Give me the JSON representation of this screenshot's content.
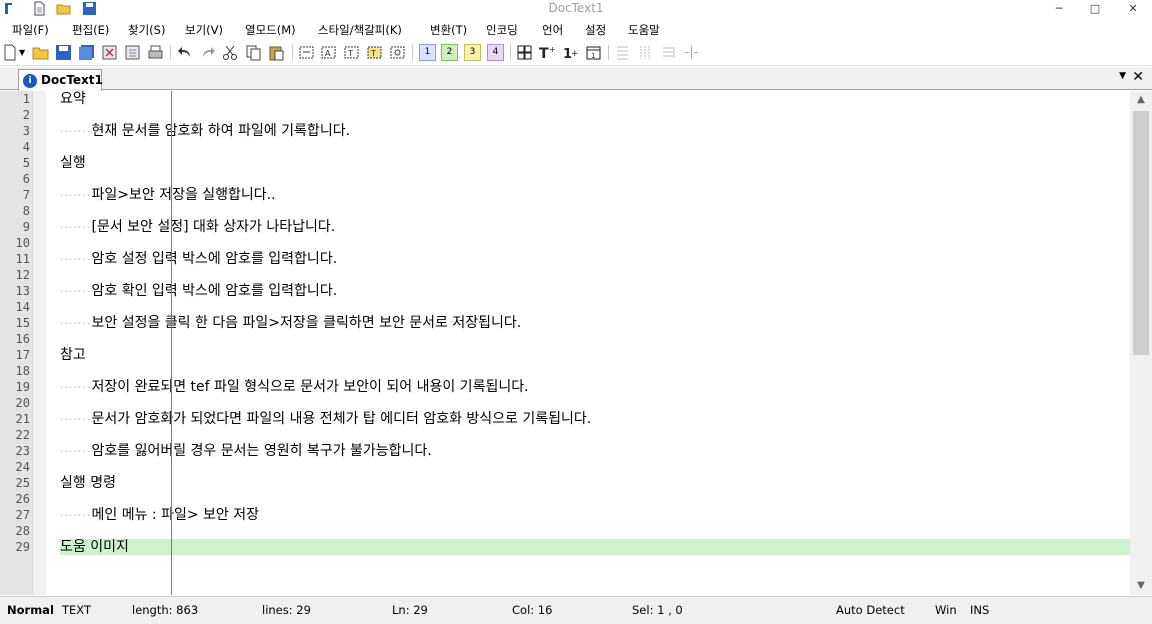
{
  "window": {
    "title": "DocText1"
  },
  "menu": [
    "파일(F)",
    "편집(E)",
    "찾기(S)",
    "보기(V)",
    "열모드(M)",
    "스타일/책갈피(K)",
    "변환(T)",
    "인코딩",
    "언어",
    "설정",
    "도움말"
  ],
  "toolbar": {
    "num_buttons": [
      "1",
      "2",
      "3",
      "4"
    ]
  },
  "tab": {
    "label": "DocText1"
  },
  "lines": [
    {
      "num": "1",
      "indent": false,
      "text": "요약"
    },
    {
      "num": "2",
      "indent": false,
      "text": ""
    },
    {
      "num": "3",
      "indent": true,
      "text": "현재 문서를 암호화 하여 파일에 기록합니다."
    },
    {
      "num": "4",
      "indent": false,
      "text": ""
    },
    {
      "num": "5",
      "indent": false,
      "text": "실행"
    },
    {
      "num": "6",
      "indent": false,
      "text": ""
    },
    {
      "num": "7",
      "indent": true,
      "text": "파일>보안 저장을 실행합니다.."
    },
    {
      "num": "8",
      "indent": false,
      "text": ""
    },
    {
      "num": "9",
      "indent": true,
      "text": "[문서 보안 설정] 대화 상자가 나타납니다."
    },
    {
      "num": "10",
      "indent": false,
      "text": ""
    },
    {
      "num": "11",
      "indent": true,
      "text": "암호 설정 입력 박스에 암호를 입력합니다."
    },
    {
      "num": "12",
      "indent": false,
      "text": ""
    },
    {
      "num": "13",
      "indent": true,
      "text": "암호 확인 입력 박스에 암호를 입력합니다."
    },
    {
      "num": "14",
      "indent": false,
      "text": ""
    },
    {
      "num": "15",
      "indent": true,
      "text": "보안 설정을 클릭 한 다음 파일>저장을 클릭하면 보안 문서로 저장됩니다."
    },
    {
      "num": "16",
      "indent": false,
      "text": ""
    },
    {
      "num": "17",
      "indent": false,
      "text": "참고"
    },
    {
      "num": "18",
      "indent": false,
      "text": ""
    },
    {
      "num": "19",
      "indent": true,
      "text": "저장이 완료되면 tef 파일 형식으로 문서가 보안이 되어 내용이 기록됩니다."
    },
    {
      "num": "20",
      "indent": false,
      "text": ""
    },
    {
      "num": "21",
      "indent": true,
      "text": "문서가 암호화가 되었다면 파일의 내용 전체가 탑 에디터 암호화 방식으로 기록됩니다."
    },
    {
      "num": "22",
      "indent": false,
      "text": ""
    },
    {
      "num": "23",
      "indent": true,
      "text": "암호를 잃어버릴 경우 문서는 영원히 복구가 불가능합니다."
    },
    {
      "num": "24",
      "indent": false,
      "text": ""
    },
    {
      "num": "25",
      "indent": false,
      "text": "실행 명령"
    },
    {
      "num": "26",
      "indent": false,
      "text": ""
    },
    {
      "num": "27",
      "indent": true,
      "text": "메인 메뉴 : 파일> 보안 저장"
    },
    {
      "num": "28",
      "indent": false,
      "text": ""
    },
    {
      "num": "29",
      "indent": false,
      "text": "도움 이미지"
    }
  ],
  "status": {
    "mode": "Normal",
    "type": "TEXT",
    "length": "length: 863",
    "lines": "lines: 29",
    "ln": "Ln: 29",
    "col": "Col: 16",
    "sel": "Sel: 1 , 0",
    "detect": "Auto Detect",
    "eol": "Win",
    "ins": "INS"
  },
  "colors": {
    "current_line": "#cdf3cd",
    "edge_line": "#c8632c",
    "gutter": "#e4e4e4"
  }
}
